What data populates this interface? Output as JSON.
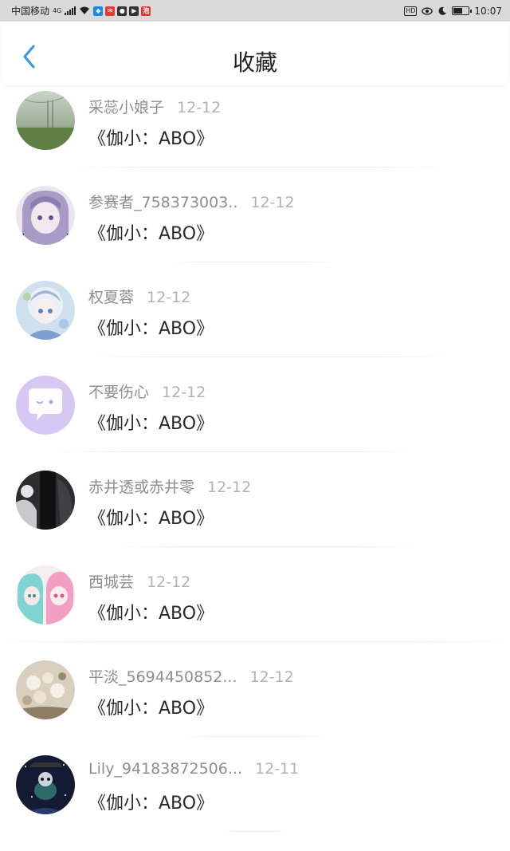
{
  "status_bar": {
    "carrier": "中国移动",
    "network": "4G",
    "time": "10:07",
    "hd_label": "HD",
    "app_icons": [
      {
        "name": "shield-app-icon",
        "color": "#1e88e5",
        "glyph": "◆"
      },
      {
        "name": "red-app-icon",
        "color": "#e53935",
        "glyph": "✉"
      },
      {
        "name": "wechat-icon",
        "color": "#333333",
        "glyph": "●"
      },
      {
        "name": "dark-app-icon",
        "color": "#333333",
        "glyph": "▶"
      },
      {
        "name": "orange-app-icon",
        "color": "#e53935",
        "glyph": "泡"
      }
    ]
  },
  "header": {
    "title": "收藏",
    "back_icon": "chevron-left-icon"
  },
  "colors": {
    "accent": "#3a93e6",
    "username": "#8e8e8e",
    "date": "#b3b3b3",
    "title": "#2a2a2a"
  },
  "items": [
    {
      "username": "采蕊小娘子",
      "date": "12-12",
      "title": "《伽小：ABO》",
      "avatar": "landscape"
    },
    {
      "username": "参赛者_758373003..",
      "date": "12-12",
      "title": "《伽小：ABO》",
      "avatar": "anime-purple"
    },
    {
      "username": "权夏蓉",
      "date": "12-12",
      "title": "《伽小：ABO》",
      "avatar": "anime-blue"
    },
    {
      "username": "不要伤心",
      "date": "12-12",
      "title": "《伽小：ABO》",
      "avatar": "default-chat"
    },
    {
      "username": "赤井透或赤井零",
      "date": "12-12",
      "title": "《伽小：ABO》",
      "avatar": "dark-photo"
    },
    {
      "username": "西城芸",
      "date": "12-12",
      "title": "《伽小：ABO》",
      "avatar": "anime-pink"
    },
    {
      "username": "平淡_5694450852...",
      "date": "12-12",
      "title": "《伽小：ABO》",
      "avatar": "flowers"
    },
    {
      "username": "Lily_94183872506...",
      "date": "12-11",
      "title": "《伽小：ABO》",
      "avatar": "night-sky"
    }
  ]
}
